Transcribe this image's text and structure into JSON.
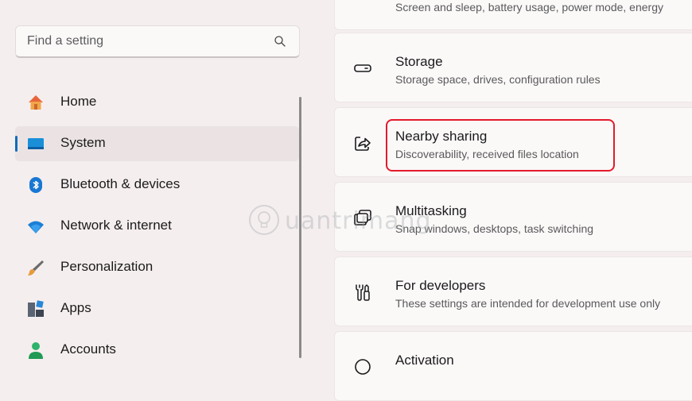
{
  "search": {
    "placeholder": "Find a setting"
  },
  "sidebar": {
    "items": [
      {
        "label": "Home",
        "icon": "home-icon"
      },
      {
        "label": "System",
        "icon": "system-icon",
        "selected": true
      },
      {
        "label": "Bluetooth & devices",
        "icon": "bluetooth-icon"
      },
      {
        "label": "Network & internet",
        "icon": "wifi-icon"
      },
      {
        "label": "Personalization",
        "icon": "brush-icon"
      },
      {
        "label": "Apps",
        "icon": "apps-icon"
      },
      {
        "label": "Accounts",
        "icon": "accounts-icon"
      }
    ]
  },
  "main": {
    "cards": [
      {
        "title": "",
        "subtitle": "Screen and sleep, battery usage, power mode, energy",
        "icon": ""
      },
      {
        "title": "Storage",
        "subtitle": "Storage space, drives, configuration rules",
        "icon": "storage-icon"
      },
      {
        "title": "Nearby sharing",
        "subtitle": "Discoverability, received files location",
        "icon": "share-icon"
      },
      {
        "title": "Multitasking",
        "subtitle": "Snap windows, desktops, task switching",
        "icon": "multitasking-icon"
      },
      {
        "title": "For developers",
        "subtitle": "These settings are intended for development use only",
        "icon": "developer-tools-icon"
      },
      {
        "title": "Activation",
        "subtitle": "",
        "icon": "activation-icon"
      }
    ]
  },
  "watermark": {
    "text": "uantrimang"
  },
  "colors": {
    "accent": "#0f6cbd",
    "highlight": "#e31b2b",
    "background": "#f5eeee",
    "card": "#fbf8f8"
  }
}
